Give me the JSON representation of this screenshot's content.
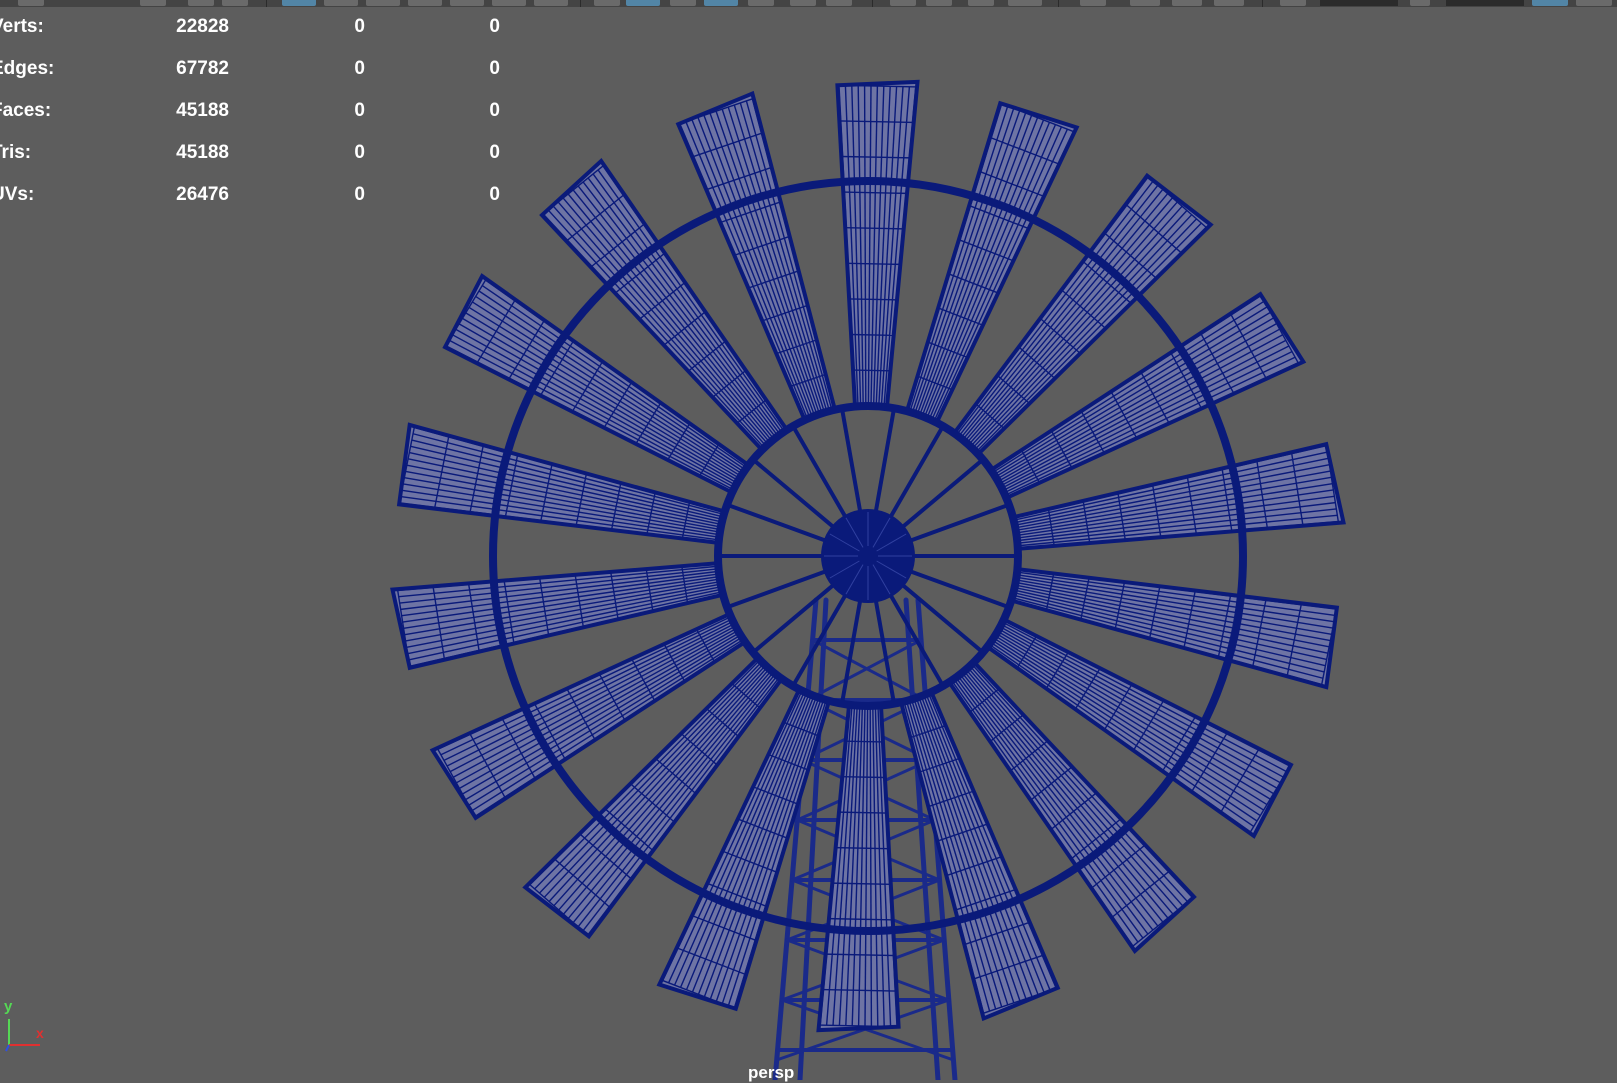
{
  "hud": {
    "rows": [
      {
        "label": "Verts:",
        "v1": "22828",
        "v2": "0",
        "v3": "0"
      },
      {
        "label": "Edges:",
        "v1": "67782",
        "v2": "0",
        "v3": "0"
      },
      {
        "label": "Faces:",
        "v1": "45188",
        "v2": "0",
        "v3": "0"
      },
      {
        "label": "Tris:",
        "v1": "45188",
        "v2": "0",
        "v3": "0"
      },
      {
        "label": "UVs:",
        "v1": "26476",
        "v2": "0",
        "v3": "0"
      }
    ]
  },
  "viewport": {
    "camera_label": "persp",
    "background_color": "#5d5d5d",
    "wireframe_color": "#0a1a7a",
    "object": "windmill-wireframe"
  },
  "axis_gizmo": {
    "y_label": "y",
    "x_label": "x",
    "y_color": "#55d855",
    "x_color": "#e03030"
  },
  "toolbar": {
    "icons": [
      "toolbar-icon"
    ]
  }
}
